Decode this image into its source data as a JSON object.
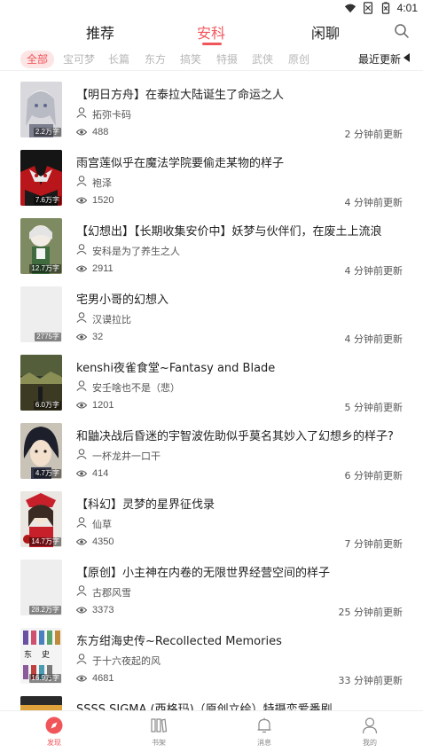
{
  "status_bar": {
    "time": "4:01",
    "icons": [
      "wifi-icon",
      "sim-no-signal-icon",
      "battery-icon"
    ]
  },
  "top_tabs": [
    {
      "label": "推荐",
      "active": false
    },
    {
      "label": "安科",
      "active": true
    },
    {
      "label": "闲聊",
      "active": false
    }
  ],
  "accent_color": "#f0555a",
  "categories": [
    "全部",
    "宝可梦",
    "长篇",
    "东方",
    "搞笑",
    "特摄",
    "武侠",
    "原创"
  ],
  "active_category": "全部",
  "sort": {
    "label": "最近更新"
  },
  "items": [
    {
      "title": "【明日方舟】在泰拉大陆诞生了命运之人",
      "author": "拓弥卡码",
      "views": "488",
      "updated": "2 分钟前更新",
      "cover_count": "2.2万字"
    },
    {
      "title": "雨宫莲似乎在魔法学院要偷走某物的样子",
      "author": "袍泽",
      "views": "1520",
      "updated": "4 分钟前更新",
      "cover_count": "7.6万字"
    },
    {
      "title": "【幻想出】【长期收集安价中】妖梦与伙伴们，在废土上流浪",
      "author": "安科是为了养生之人",
      "views": "2911",
      "updated": "4 分钟前更新",
      "cover_count": "12.7万字"
    },
    {
      "title": "宅男小哥的幻想入",
      "author": "汉谟拉比",
      "views": "32",
      "updated": "4 分钟前更新",
      "cover_count": "2775字"
    },
    {
      "title": "kenshi夜雀食堂~Fantasy and Blade",
      "author": "安壬啥也不是（悲）",
      "views": "1201",
      "updated": "5 分钟前更新",
      "cover_count": "6.0万字"
    },
    {
      "title": "和鼬决战后昏迷的宇智波佐助似乎莫名其妙入了幻想乡的样子?",
      "author": "一杯龙井一口干",
      "views": "414",
      "updated": "6 分钟前更新",
      "cover_count": "4.7万字"
    },
    {
      "title": "【科幻】灵梦的星界征伐录",
      "author": "仙草",
      "views": "4350",
      "updated": "7 分钟前更新",
      "cover_count": "14.7万字"
    },
    {
      "title": "【原创】小主神在内卷的无限世界经营空间的样子",
      "author": "古郡风雪",
      "views": "3373",
      "updated": "25 分钟前更新",
      "cover_count": "28.2万字"
    },
    {
      "title": "东方绀海史传~Recollected Memories",
      "author": "于十六夜起的风",
      "views": "4681",
      "updated": "33 分钟前更新",
      "cover_count": "16.9万字"
    },
    {
      "title": "SSSS.SIGMA (西格玛)（原创立绘）特摄恋爱番剧",
      "author": "",
      "views": "",
      "updated": "",
      "cover_count": ""
    }
  ],
  "bottom_nav": [
    {
      "label": "发现",
      "icon": "compass-icon",
      "active": true
    },
    {
      "label": "书架",
      "icon": "bookshelf-icon",
      "active": false
    },
    {
      "label": "消息",
      "icon": "bell-icon",
      "active": false
    },
    {
      "label": "我的",
      "icon": "user-icon",
      "active": false
    }
  ]
}
